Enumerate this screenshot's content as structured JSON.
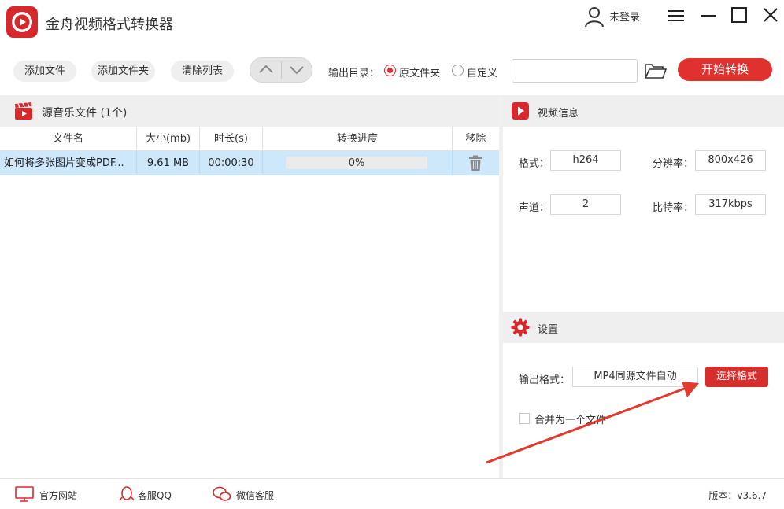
{
  "app": {
    "title": "金舟视频格式转换器"
  },
  "header": {
    "login_label": "未登录"
  },
  "toolbar": {
    "add_file": "添加文件",
    "add_folder": "添加文件夹",
    "clear_list": "清除列表",
    "output_dir_label": "输出目录：",
    "radio_original": "原文件夹",
    "radio_custom": "自定义",
    "selected_output": "原文件夹",
    "path_value": "",
    "start_label": "开始转换"
  },
  "file_panel": {
    "title": "源音乐文件 (1个)",
    "columns": [
      "文件名",
      "大小(mb)",
      "时长(s)",
      "转换进度",
      "移除"
    ],
    "rows": [
      {
        "name": "如何将多张图片变成PDF...",
        "size": "9.61 MB",
        "duration": "00:00:30",
        "progress": 0,
        "progress_label": "0%"
      }
    ]
  },
  "video_info": {
    "title": "视频信息",
    "format_label": "格式：",
    "format_value": "h264",
    "resolution_label": "分辨率：",
    "resolution_value": "800x426",
    "channel_label": "声道：",
    "channel_value": "2",
    "bitrate_label": "比特率：",
    "bitrate_value": "317kbps"
  },
  "settings": {
    "title": "设置",
    "output_format_label": "输出格式：",
    "output_format_value": "MP4同源文件自动",
    "choose_format_label": "选择格式",
    "merge_label": "合并为一个文件",
    "merge_checked": false
  },
  "footer": {
    "website": "官方网站",
    "qq": "客服QQ",
    "wechat": "微信客服",
    "version": "版本：v3.6.7"
  },
  "colors": {
    "brand_red": "#e0312f",
    "row_selected": "#cde8fb",
    "panel_header": "#efefef"
  }
}
